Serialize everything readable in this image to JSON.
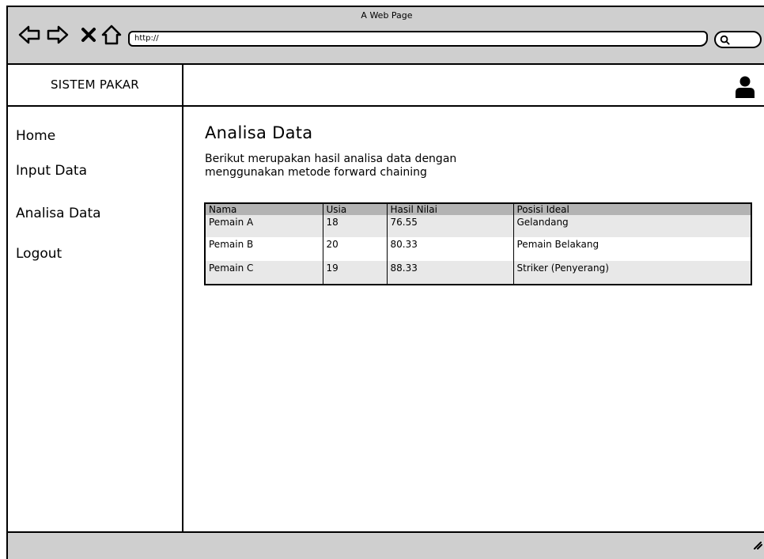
{
  "window": {
    "title": "A Web Page"
  },
  "addressbar": {
    "url": "http://"
  },
  "brand": {
    "label": "SISTEM PAKAR"
  },
  "sidebar": {
    "items": [
      {
        "label": "Home"
      },
      {
        "label": "Input Data"
      },
      {
        "label": "Analisa Data"
      },
      {
        "label": "Logout"
      }
    ]
  },
  "main": {
    "title": "Analisa Data",
    "description": "Berikut merupakan hasil analisa data dengan menggunakan metode forward chaining"
  },
  "table": {
    "headers": [
      "Nama",
      "Usia",
      "Hasil Nilai",
      "Posisi Ideal"
    ],
    "rows": [
      [
        "Pemain A",
        "18",
        "76.55",
        "Gelandang"
      ],
      [
        "Pemain B",
        "20",
        "80.33",
        "Pemain Belakang"
      ],
      [
        "Pemain C",
        "19",
        "88.33",
        "Striker (Penyerang)"
      ]
    ]
  },
  "icons": {
    "back": "back-arrow-icon",
    "forward": "forward-arrow-icon",
    "stop": "close-icon",
    "home": "home-icon",
    "search": "search-icon",
    "user": "user-icon",
    "resize": "resize-grip-icon"
  },
  "colors": {
    "chrome": "#cfcfcf",
    "table_header": "#b3b3b3",
    "row_alt": "#e8e8e8"
  }
}
